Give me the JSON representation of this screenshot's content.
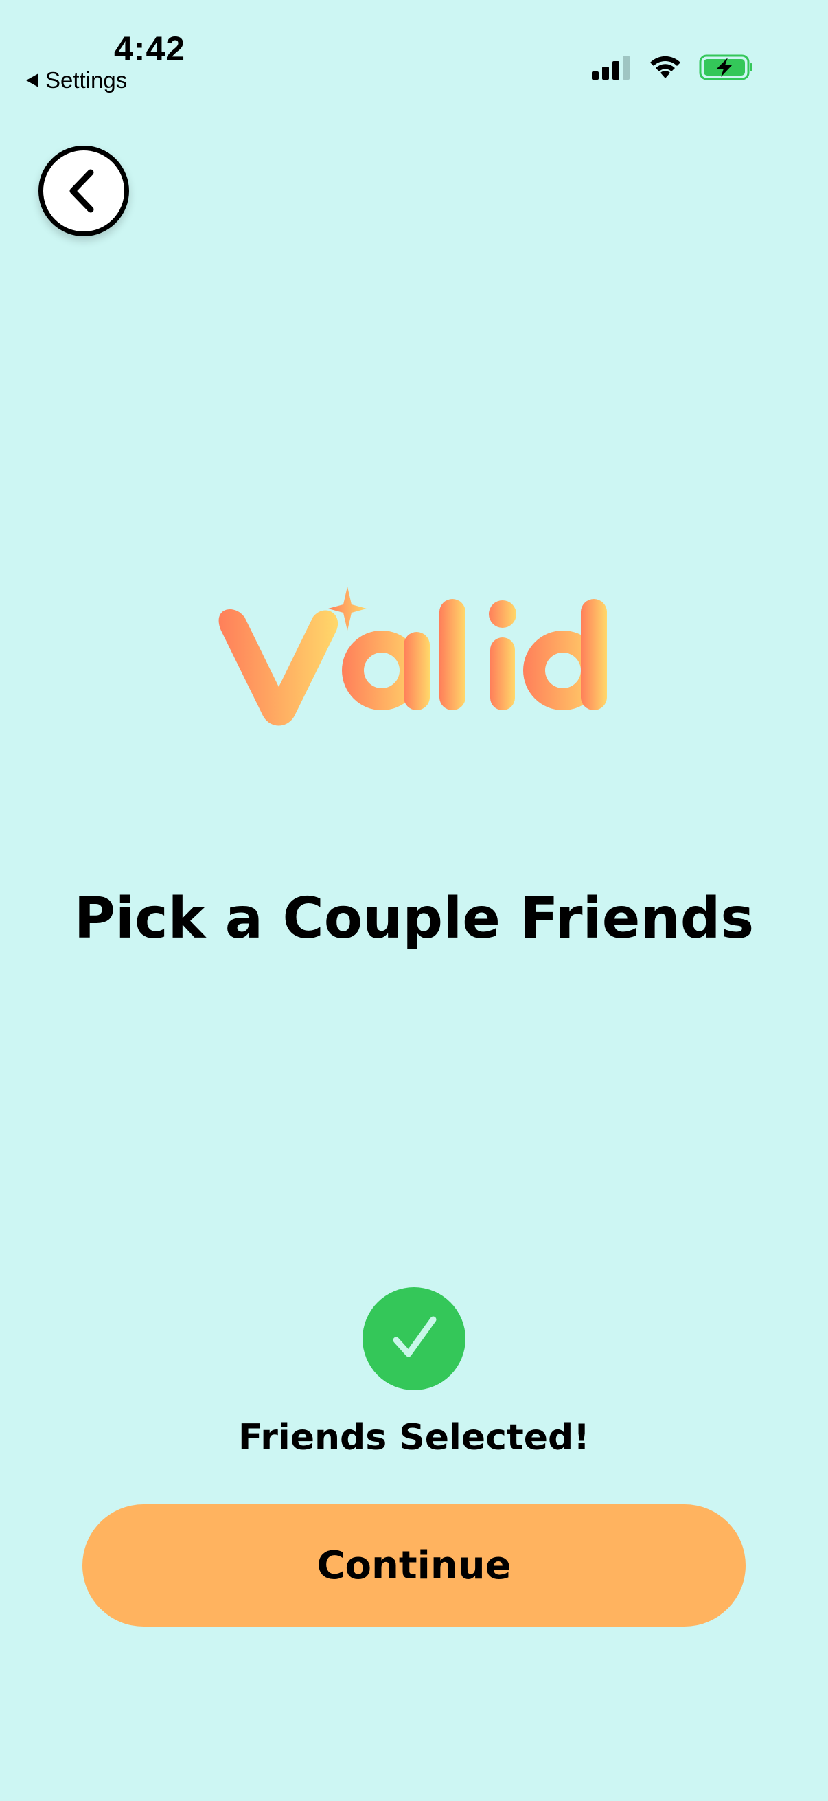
{
  "status_bar": {
    "time": "4:42",
    "back_label": "Settings",
    "icons": [
      "signal-icon",
      "wifi-icon",
      "battery-charging-icon"
    ]
  },
  "nav": {
    "back_icon": "chevron-left-icon"
  },
  "logo": {
    "text": "Valid",
    "gradient_start": "#FF7F5A",
    "gradient_end": "#FFD86A"
  },
  "main": {
    "title": "Pick a Couple Friends",
    "status_text": "Friends Selected!",
    "status_icon": "checkmark-icon",
    "continue_label": "Continue"
  },
  "colors": {
    "background": "#CDF6F3",
    "accent_button": "#FFB35F",
    "success": "#34C759"
  }
}
